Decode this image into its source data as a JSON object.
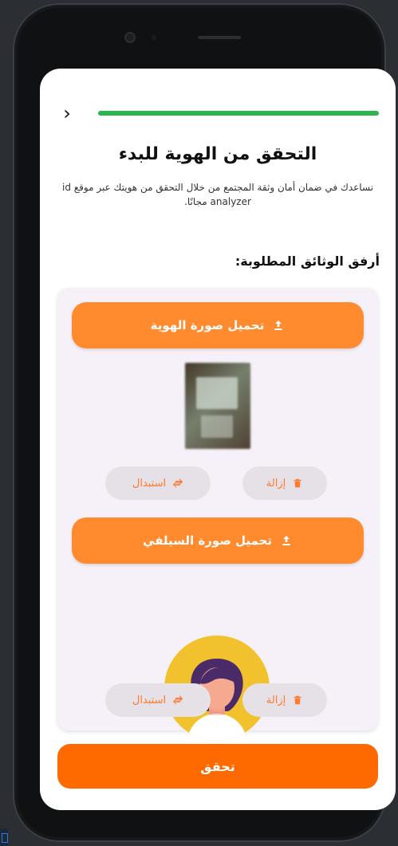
{
  "ui": {
    "progress": 1.0,
    "title": "التحقق من الهوية للبدء",
    "subtitle": "نساعدك في ضمان أمان وثقة المجتمع من خلال التحقق من هويتك عبر موقع id analyzer مجانًا.",
    "required_docs_title": "أرفق الوثائق المطلوبة:",
    "upload_id_label": "تحميل صورة الهوية",
    "upload_selfie_label": "تحميل صورة السيلفي",
    "remove_label": "إزالة",
    "replace_label": "استبدال",
    "verify_label": "تحقق",
    "colors": {
      "accent_orange": "#ff8b2e",
      "primary_orange": "#ff6a00",
      "progress_green": "#2bb64b",
      "card_bg": "#f6f0f8",
      "pill_bg": "#e6e1e7"
    }
  }
}
